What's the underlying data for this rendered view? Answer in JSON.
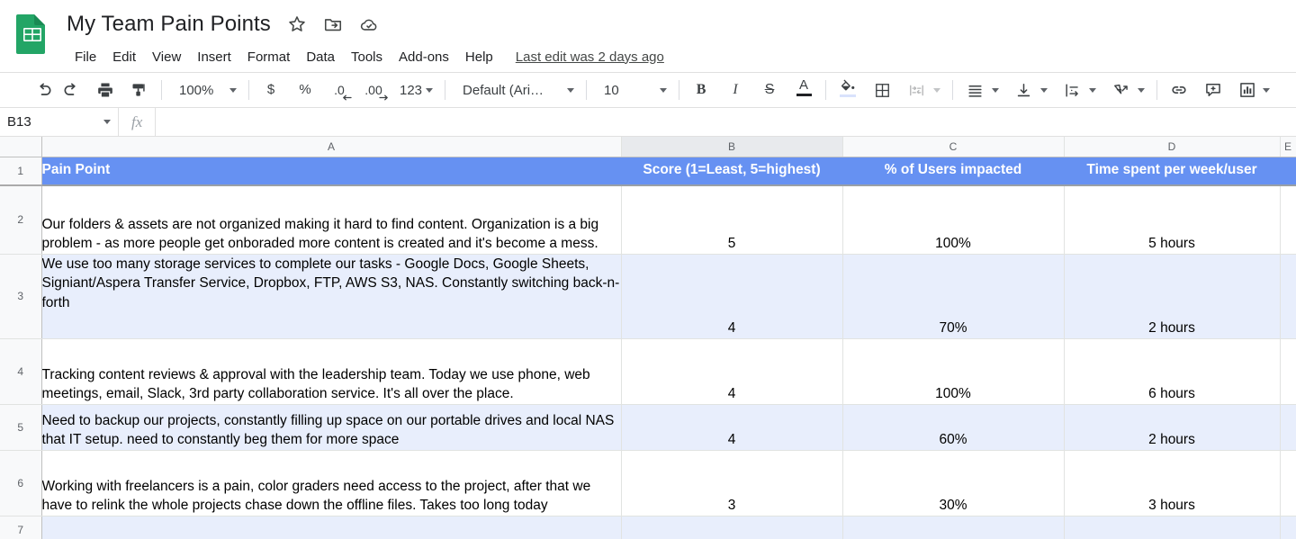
{
  "app": {
    "logo_icon": "google-sheets-logo",
    "title": "My Team Pain Points",
    "title_icons": [
      {
        "name": "star-icon",
        "glyph": "star"
      },
      {
        "name": "move-to-folder-icon",
        "glyph": "folder-move"
      },
      {
        "name": "cloud-saved-icon",
        "glyph": "cloud-check"
      }
    ],
    "last_edit": "Last edit was 2 days ago"
  },
  "menubar": {
    "items": [
      {
        "label": "File"
      },
      {
        "label": "Edit"
      },
      {
        "label": "View"
      },
      {
        "label": "Insert"
      },
      {
        "label": "Format"
      },
      {
        "label": "Data"
      },
      {
        "label": "Tools"
      },
      {
        "label": "Add-ons"
      },
      {
        "label": "Help"
      }
    ]
  },
  "toolbar": {
    "undo_icon": "undo-icon",
    "redo_icon": "redo-icon",
    "print_icon": "print-icon",
    "paint_format_icon": "paint-format-icon",
    "zoom_value": "100%",
    "currency_label": "$",
    "percent_label": "%",
    "decrease_decimal_label": ".0",
    "increase_decimal_label": ".00",
    "more_formats_label": "123",
    "font_family_value": "Default (Ari…",
    "font_size_value": "10",
    "bold_label": "B",
    "italic_label": "I",
    "strikethrough_label": "S",
    "text_color_label": "A",
    "fill_color_icon": "fill-color-icon",
    "borders_icon": "borders-icon",
    "merge_cells_icon": "merge-cells-icon",
    "horizontal_align_icon": "horizontal-align-icon",
    "vertical_align_icon": "vertical-align-icon",
    "text_wrap_icon": "text-wrap-icon",
    "text_rotation_icon": "text-rotation-icon",
    "insert_link_icon": "insert-link-icon",
    "insert_comment_icon": "insert-comment-icon",
    "insert_chart_icon": "insert-chart-icon",
    "overflow_icon": "toolbar-overflow-icon"
  },
  "formula_bar": {
    "name_box_value": "B13",
    "fx_label": "fx",
    "formula_value": "",
    "formula_placeholder": ""
  },
  "grid": {
    "columns": [
      {
        "letter": "A",
        "active": false
      },
      {
        "letter": "B",
        "active": true
      },
      {
        "letter": "C",
        "active": false
      },
      {
        "letter": "D",
        "active": false
      },
      {
        "letter": "E",
        "active": false
      }
    ],
    "header_row": {
      "number": "1",
      "cells": [
        "Pain Point",
        "Score (1=Least, 5=highest)",
        "% of Users impacted",
        "Time spent per week/user",
        ""
      ]
    },
    "rows": [
      {
        "number": "2",
        "banded": false,
        "pain_point": "Our folders & assets are not organized making it hard to find content. Organization is a big problem - as more people get onboraded more content is created and it's become a mess.",
        "score": "5",
        "users_impacted": "100%",
        "time_spent": "5 hours",
        "extra": ""
      },
      {
        "number": "3",
        "banded": true,
        "pain_point": "We use too many storage services to complete our tasks - Google Docs, Google Sheets, Signiant/Aspera Transfer Service, Dropbox, FTP, AWS S3, NAS. Constantly switching back-n-forth",
        "score": "4",
        "users_impacted": "70%",
        "time_spent": "2 hours",
        "extra": ""
      },
      {
        "number": "4",
        "banded": false,
        "pain_point": "Tracking content reviews & approval with the  leadership team. Today we use phone, web meetings, email, Slack, 3rd party collaboration service. It's all over the place.",
        "score": "4",
        "users_impacted": "100%",
        "time_spent": "6 hours",
        "extra": ""
      },
      {
        "number": "5",
        "banded": true,
        "pain_point": "Need to backup our projects, constantly filling up space on our portable drives and local NAS that IT setup. need to constantly beg them for more space",
        "score": "4",
        "users_impacted": "60%",
        "time_spent": "2 hours",
        "extra": ""
      },
      {
        "number": "6",
        "banded": false,
        "pain_point": "Working with freelancers is a pain, color graders need access to the project, after that we have to relink the whole projects chase down the offline files. Takes too long today",
        "score": "3",
        "users_impacted": "30%",
        "time_spent": "3 hours",
        "extra": ""
      },
      {
        "number": "7",
        "banded": true,
        "pain_point": "",
        "score": "",
        "users_impacted": "",
        "time_spent": "",
        "extra": ""
      }
    ]
  },
  "colors": {
    "header_blue": "#6691f2",
    "band_blue": "#e8eefc",
    "sheets_green": "#23a566",
    "grid_line": "#e1e3e1",
    "text": "#202124"
  }
}
